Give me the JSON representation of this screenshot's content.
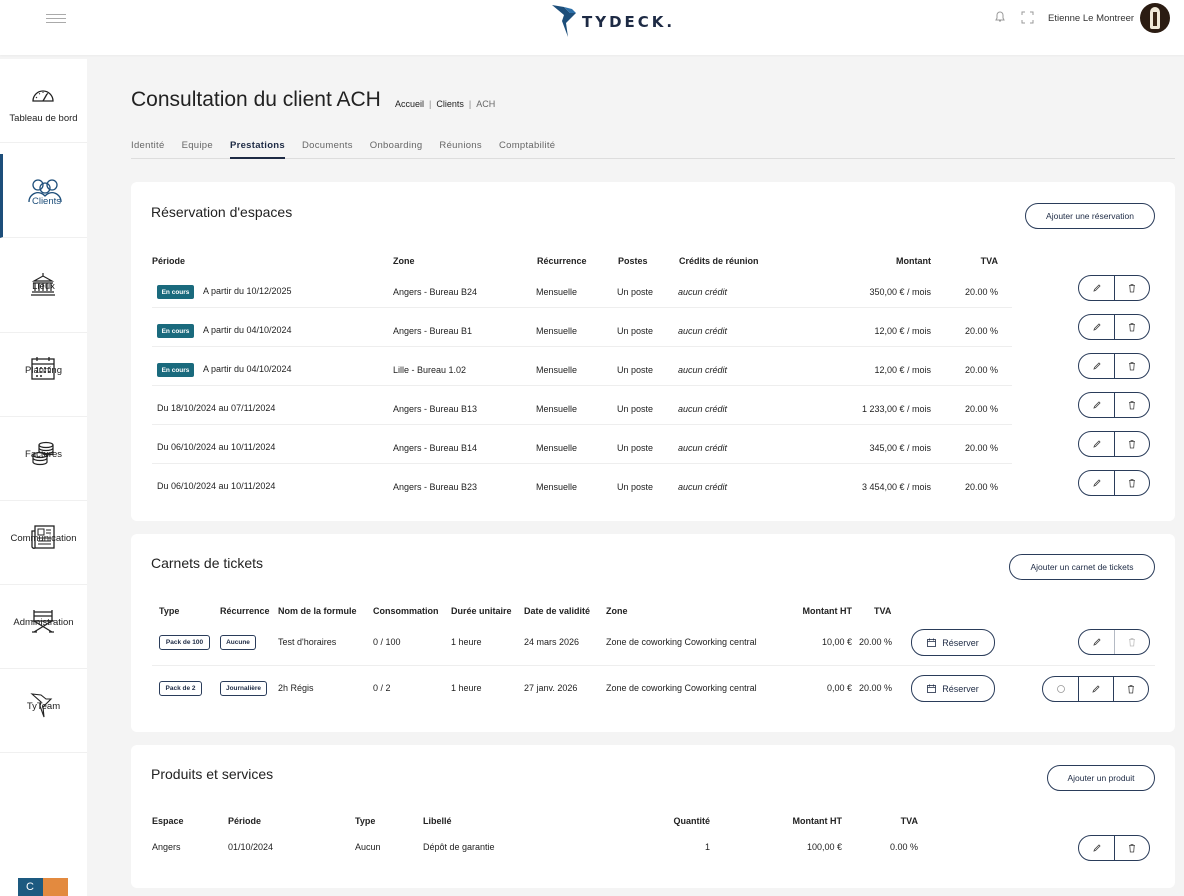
{
  "app": {
    "brand": "TYDECK.",
    "user_name": "Etienne Le Montreer"
  },
  "icons": {
    "menu": "menu-icon",
    "bell": "bell-icon",
    "fullscreen": "fullscreen-icon",
    "edit": "pencil-icon",
    "delete": "trash-icon",
    "calendar": "calendar-icon",
    "circle": "circle-icon"
  },
  "colors": {
    "primary": "#1d2a44",
    "badge": "#1a6a7d",
    "active_nav": "#1d4e7a",
    "accent_orange": "#e38a3f"
  },
  "sidebar": {
    "items": [
      {
        "label": "Tableau de bord",
        "icon": "gauge-icon"
      },
      {
        "label": "Clients",
        "icon": "users-icon"
      },
      {
        "label": "Lieux",
        "icon": "building-icon"
      },
      {
        "label": "Planning",
        "icon": "calendar-icon"
      },
      {
        "label": "Factures",
        "icon": "coins-icon"
      },
      {
        "label": "Communication",
        "icon": "newspaper-icon"
      },
      {
        "label": "Administration",
        "icon": "director-chair-icon"
      },
      {
        "label": "TyTeam",
        "icon": "hummingbird-icon"
      }
    ],
    "active": "Clients"
  },
  "page": {
    "title": "Consultation du client ACH",
    "breadcrumb": [
      "Accueil",
      "Clients",
      "ACH"
    ],
    "tabs": [
      "Identité",
      "Equipe",
      "Prestations",
      "Documents",
      "Onboarding",
      "Réunions",
      "Comptabilité"
    ],
    "active_tab": "Prestations"
  },
  "reservations": {
    "title": "Réservation d'espaces",
    "add_label": "Ajouter une réservation",
    "headers": [
      "Période",
      "Zone",
      "Récurrence",
      "Postes",
      "Crédits de réunion",
      "Montant",
      "TVA"
    ],
    "rows": [
      {
        "badge": "En cours",
        "period": "A partir du 10/12/2025",
        "zone": "Angers - Bureau B24",
        "recurrence": "Mensuelle",
        "posts": "Un poste",
        "credits": "aucun crédit",
        "amount": "350,00 € / mois",
        "tva": "20.00 %"
      },
      {
        "badge": "En cours",
        "period": "A partir du 04/10/2024",
        "zone": "Angers - Bureau B1",
        "recurrence": "Mensuelle",
        "posts": "Un poste",
        "credits": "aucun crédit",
        "amount": "12,00 € / mois",
        "tva": "20.00 %"
      },
      {
        "badge": "En cours",
        "period": "A partir du 04/10/2024",
        "zone": "Lille - Bureau 1.02",
        "recurrence": "Mensuelle",
        "posts": "Un poste",
        "credits": "aucun crédit",
        "amount": "12,00 € / mois",
        "tva": "20.00 %"
      },
      {
        "badge": "",
        "period": "Du 18/10/2024 au 07/11/2024",
        "zone": "Angers - Bureau B13",
        "recurrence": "Mensuelle",
        "posts": "Un poste",
        "credits": "aucun crédit",
        "amount": "1 233,00 € / mois",
        "tva": "20.00 %"
      },
      {
        "badge": "",
        "period": "Du 06/10/2024 au 10/11/2024",
        "zone": "Angers - Bureau B14",
        "recurrence": "Mensuelle",
        "posts": "Un poste",
        "credits": "aucun crédit",
        "amount": "345,00 € / mois",
        "tva": "20.00 %"
      },
      {
        "badge": "",
        "period": "Du 06/10/2024 au 10/11/2024",
        "zone": "Angers - Bureau B23",
        "recurrence": "Mensuelle",
        "posts": "Un poste",
        "credits": "aucun crédit",
        "amount": "3 454,00 € / mois",
        "tva": "20.00 %"
      }
    ]
  },
  "tickets": {
    "title": "Carnets de tickets",
    "add_label": "Ajouter un carnet de tickets",
    "headers": [
      "Type",
      "Récurrence",
      "Nom de la formule",
      "Consommation",
      "Durée unitaire",
      "Date de validité",
      "Zone",
      "Montant HT",
      "TVA"
    ],
    "reserve_label": "Réserver",
    "rows": [
      {
        "type": "Pack de 100",
        "recurrence": "Aucune",
        "name": "Test d'horaires",
        "consumption": "0 / 100",
        "duration": "1 heure",
        "validity": "24 mars 2026",
        "zone": "Zone de coworking Coworking central",
        "amount": "10,00 €",
        "tva": "20.00 %"
      },
      {
        "type": "Pack de 2",
        "recurrence": "Journalière",
        "name": "2h Régis",
        "consumption": "0 / 2",
        "duration": "1 heure",
        "validity": "27 janv. 2026",
        "zone": "Zone de coworking Coworking central",
        "amount": "0,00 €",
        "tva": "20.00 %"
      }
    ]
  },
  "products": {
    "title": "Produits et services",
    "add_label": "Ajouter un produit",
    "headers": [
      "Espace",
      "Période",
      "Type",
      "Libellé",
      "Quantité",
      "Montant HT",
      "TVA"
    ],
    "rows": [
      {
        "space": "Angers",
        "period": "01/10/2024",
        "type": "Aucun",
        "label": "Dépôt de garantie",
        "quantity": "1",
        "amount": "100,00 €",
        "tva": "0.00 %"
      }
    ]
  }
}
